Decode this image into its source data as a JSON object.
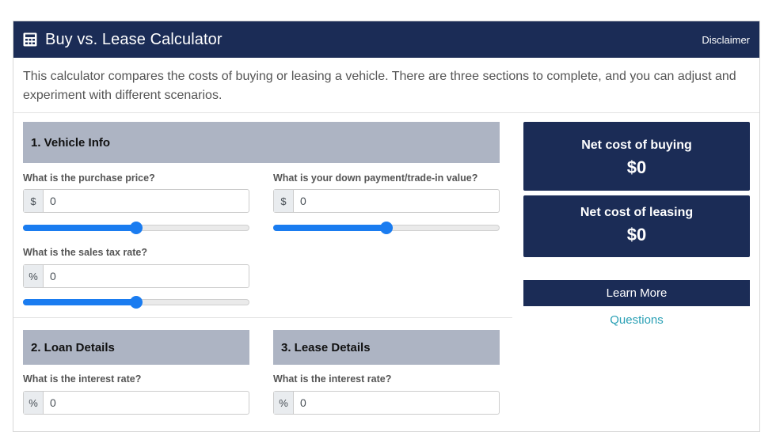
{
  "header": {
    "title": "Buy vs. Lease Calculator",
    "disclaimer_label": "Disclaimer",
    "icon": "calculator-icon"
  },
  "intro": {
    "text": "This calculator compares the costs of buying or leasing a vehicle. There are three sections to complete, and you can adjust and experiment with different scenarios."
  },
  "vehicle_info": {
    "heading": "1. Vehicle Info",
    "purchase_price": {
      "label": "What is the purchase price?",
      "prefix": "$",
      "value": "0",
      "slider_level": 0.5
    },
    "down_payment": {
      "label": "What is your down payment/trade-in value?",
      "prefix": "$",
      "value": "0",
      "slider_level": 0.5
    },
    "sales_tax": {
      "label": "What is the sales tax rate?",
      "prefix": "%",
      "value": "0",
      "slider_level": 0.5
    }
  },
  "loan_details": {
    "heading": "2. Loan Details",
    "interest_rate": {
      "label": "What is the interest rate?",
      "prefix": "%",
      "value": "0"
    }
  },
  "lease_details": {
    "heading": "3. Lease Details",
    "interest_rate": {
      "label": "What is the interest rate?",
      "prefix": "%",
      "value": "0"
    }
  },
  "results": {
    "buying_label": "Net cost of buying",
    "buying_value": "$0",
    "leasing_label": "Net cost of leasing",
    "leasing_value": "$0"
  },
  "actions": {
    "learn_more_label": "Learn More",
    "questions_label": "Questions"
  },
  "colors": {
    "primary": "#1b2c56",
    "section_header": "#adb4c3",
    "slider": "#1a7cf0",
    "link": "#2aa0b5"
  }
}
